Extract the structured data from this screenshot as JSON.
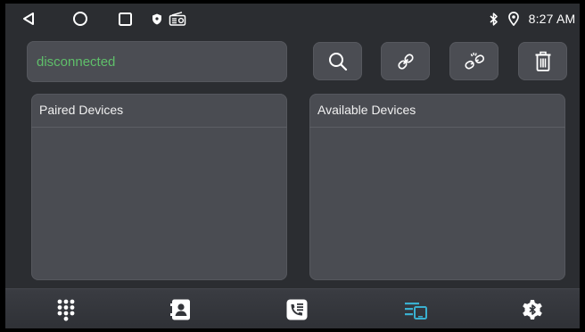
{
  "status_bar": {
    "time": "8:27 AM",
    "icons": [
      "back-icon",
      "home-icon",
      "recents-icon",
      "shield-icon",
      "radio-icon",
      "bluetooth-icon",
      "location-icon"
    ]
  },
  "connection": {
    "status_text": "disconnected",
    "status_color": "#5fbf6a"
  },
  "toolbar": {
    "buttons": [
      "search-icon",
      "link-icon",
      "unlink-icon",
      "trash-icon"
    ]
  },
  "panels": {
    "paired_title": "Paired Devices",
    "available_title": "Available Devices"
  },
  "bottom_nav": {
    "items": [
      "dialpad-icon",
      "contacts-icon",
      "call-log-icon",
      "bluetooth-devices-icon",
      "bluetooth-settings-icon"
    ],
    "active_item": "bluetooth-devices-icon",
    "active_color": "#3ab0d0"
  }
}
